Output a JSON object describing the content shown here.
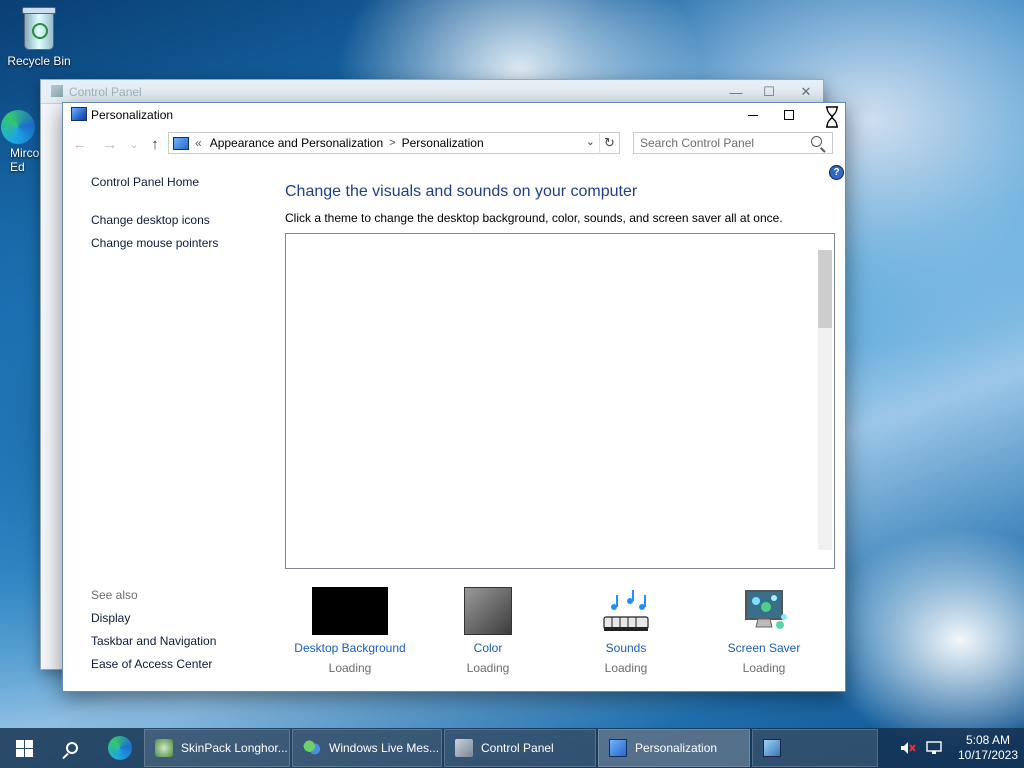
{
  "desktop": {
    "recycle_bin": "Recycle Bin",
    "edge_label": "Mirco Ed"
  },
  "bg_window": {
    "title": "Control Panel",
    "min": "—",
    "max": "☐",
    "close": "✕"
  },
  "window": {
    "title": "Personalization",
    "nav": {
      "back": "←",
      "forward": "→",
      "recent": "⌄",
      "up": "↑"
    },
    "address": {
      "chevrons": "«",
      "crumb1": "Appearance and Personalization",
      "sep": ">",
      "crumb2": "Personalization",
      "dropdown": "⌄",
      "refresh": "↻"
    },
    "search_placeholder": "Search Control Panel",
    "help": "?",
    "sidebar": {
      "home": "Control Panel Home",
      "links": [
        "Change desktop icons",
        "Change mouse pointers"
      ],
      "see_also_heading": "See also",
      "see_also": [
        "Display",
        "Taskbar and Navigation",
        "Ease of Access Center"
      ]
    },
    "heading": "Change the visuals and sounds on your computer",
    "subtitle": "Click a theme to change the desktop background, color, sounds, and screen saver all at once.",
    "scroll_position": 0,
    "bottom_items": [
      {
        "label": "Desktop Background",
        "status": "Loading",
        "icon": "desktop-background-icon"
      },
      {
        "label": "Color",
        "status": "Loading",
        "icon": "color-icon"
      },
      {
        "label": "Sounds",
        "status": "Loading",
        "icon": "sounds-icon"
      },
      {
        "label": "Screen Saver",
        "status": "Loading",
        "icon": "screen-saver-icon"
      }
    ]
  },
  "taskbar": {
    "tasks": [
      {
        "label": "SkinPack Longhor...",
        "icon": "skinpack-icon",
        "active": false
      },
      {
        "label": "Windows Live Mes...",
        "icon": "messenger-icon",
        "active": false
      },
      {
        "label": "Control Panel",
        "icon": "control-panel-icon",
        "active": false
      },
      {
        "label": "Personalization",
        "icon": "personalization-icon",
        "active": true
      }
    ],
    "clock_time": "5:08 AM",
    "clock_date": "10/17/2023"
  },
  "colors": {
    "link_blue": "#1a5fb4",
    "heading_blue": "#1e3f8a",
    "taskbar": "#14304e"
  }
}
